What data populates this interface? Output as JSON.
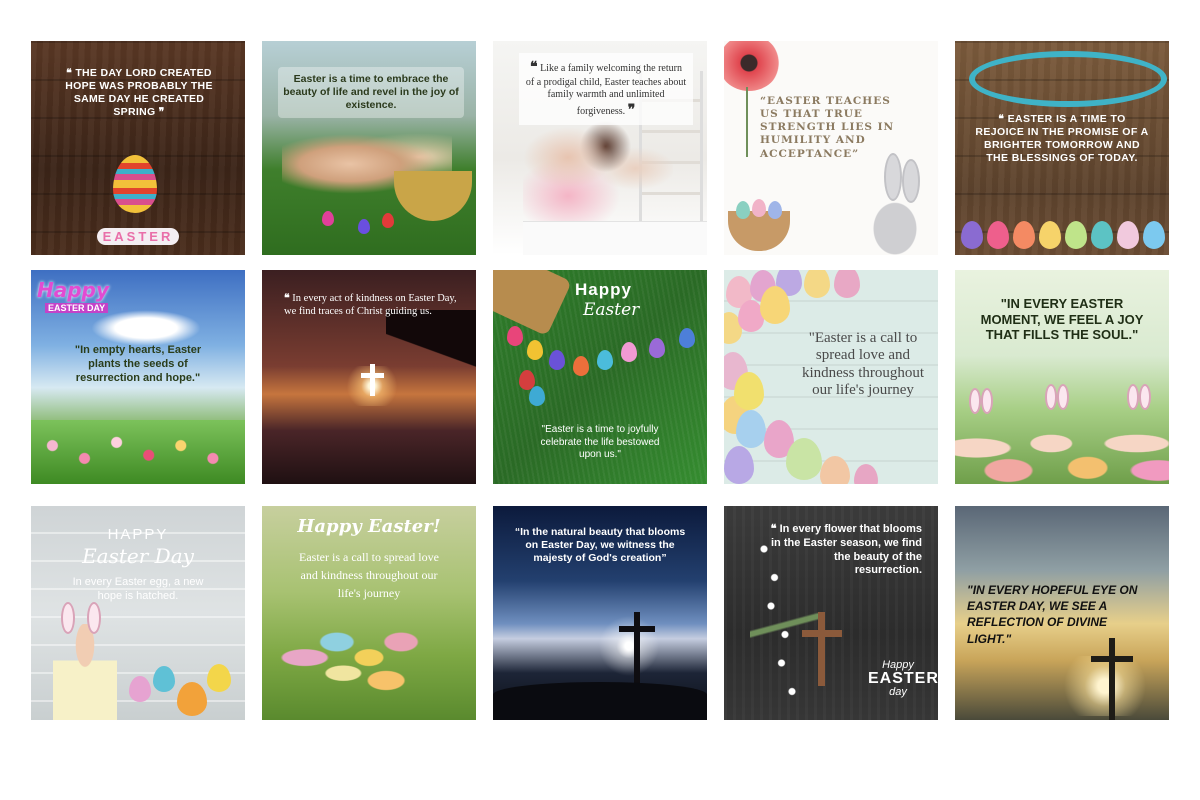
{
  "cards": [
    {
      "quote": "THE DAY LORD CREATED HOPE WAS PROBABLY THE SAME DAY HE CREATED SPRING",
      "badge": "EASTER",
      "open_q": "❝",
      "close_q": "❞"
    },
    {
      "quote": "Easter is a time to embrace the beauty of life and revel in the joy of existence."
    },
    {
      "quote": "Like a family welcoming the return of a prodigal child, Easter teaches about family warmth and unlimited forgiveness.",
      "open_q": "❝",
      "close_q": "❞"
    },
    {
      "quote": "“EASTER TEACHES US THAT TRUE STRENGTH LIES IN HUMILITY AND ACCEPTANCE”"
    },
    {
      "quote": "EASTER IS A TIME TO REJOICE IN THE PROMISE OF A BRIGHTER TOMORROW AND THE BLESSINGS OF TODAY.",
      "open_q": "❝"
    },
    {
      "title": "Happy",
      "subtitle": "EASTER DAY",
      "quote": "\"In empty hearts, Easter plants the seeds of resurrection and hope.\""
    },
    {
      "quote": "In every act of kindness on Easter Day, we find traces of Christ guiding us.",
      "open_q": "❝"
    },
    {
      "title": "Happy",
      "subtitle": "Easter",
      "quote": "\"Easter is a time to joyfully celebrate the life bestowed upon us.\""
    },
    {
      "quote": "\"Easter is a call to spread love and kindness throughout our life's journey"
    },
    {
      "quote": "\"IN EVERY EASTER MOMENT, WE FEEL A JOY THAT FILLS THE SOUL.\""
    },
    {
      "title": "HAPPY",
      "subtitle": "Easter Day",
      "quote": "In every Easter egg, a new hope is hatched."
    },
    {
      "title": "Happy Easter!",
      "quote": "Easter is a call to spread love and kindness throughout our life's journey"
    },
    {
      "quote": "“In the natural beauty that blooms on Easter Day, we witness the majesty of God's creation”"
    },
    {
      "quote": "In every flower that blooms in the Easter season, we find the beauty of the resurrection.",
      "open_q": "❝",
      "sign_top": "Happy",
      "sign_mid": "EASTER",
      "sign_bot": "day"
    },
    {
      "quote": "\"IN EVERY HOPEFUL EYE ON EASTER DAY, WE SEE A REFLECTION OF DIVINE LIGHT.\""
    }
  ]
}
